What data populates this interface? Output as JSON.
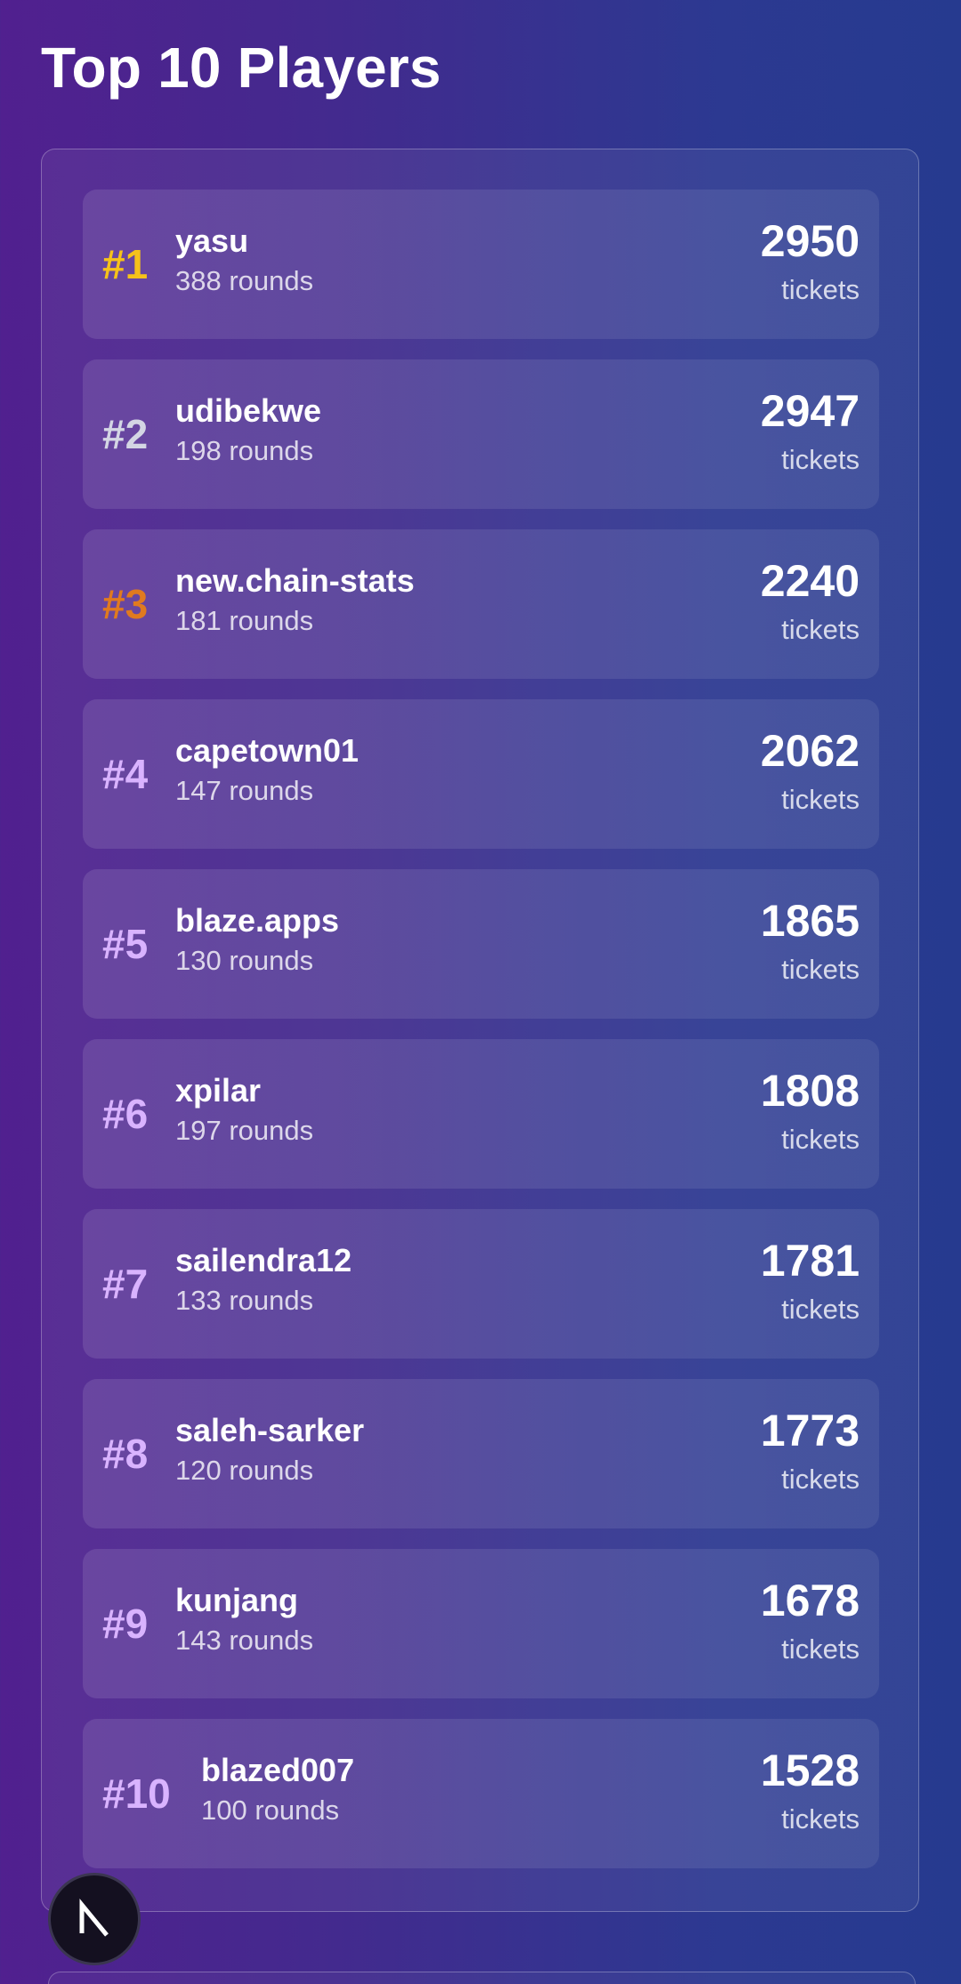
{
  "page": {
    "title": "Top 10 Players"
  },
  "leaderboard": [
    {
      "rank": "#1",
      "name": "yasu",
      "rounds": "388 rounds",
      "tickets": "2950",
      "unit": "tickets",
      "rank_color": "#f6c21a"
    },
    {
      "rank": "#2",
      "name": "udibekwe",
      "rounds": "198 rounds",
      "tickets": "2947",
      "unit": "tickets",
      "rank_color": "#d4d6e4"
    },
    {
      "rank": "#3",
      "name": "new.chain-stats",
      "rounds": "181 rounds",
      "tickets": "2240",
      "unit": "tickets",
      "rank_color": "#e07a1f"
    },
    {
      "rank": "#4",
      "name": "capetown01",
      "rounds": "147 rounds",
      "tickets": "2062",
      "unit": "tickets",
      "rank_color": "#d9b3ff"
    },
    {
      "rank": "#5",
      "name": "blaze.apps",
      "rounds": "130 rounds",
      "tickets": "1865",
      "unit": "tickets",
      "rank_color": "#d9b3ff"
    },
    {
      "rank": "#6",
      "name": "xpilar",
      "rounds": "197 rounds",
      "tickets": "1808",
      "unit": "tickets",
      "rank_color": "#d9b3ff"
    },
    {
      "rank": "#7",
      "name": "sailendra12",
      "rounds": "133 rounds",
      "tickets": "1781",
      "unit": "tickets",
      "rank_color": "#d9b3ff"
    },
    {
      "rank": "#8",
      "name": "saleh-sarker",
      "rounds": "120 rounds",
      "tickets": "1773",
      "unit": "tickets",
      "rank_color": "#d9b3ff"
    },
    {
      "rank": "#9",
      "name": "kunjang",
      "rounds": "143 rounds",
      "tickets": "1678",
      "unit": "tickets",
      "rank_color": "#d9b3ff"
    },
    {
      "rank": "#10",
      "name": "blazed007",
      "rounds": "100 rounds",
      "tickets": "1528",
      "unit": "tickets",
      "rank_color": "#d9b3ff"
    }
  ],
  "badge": {
    "icon": "nextjs-n-icon",
    "letter": "N"
  },
  "colors": {
    "background_start": "#51208f",
    "background_end": "#263a8f",
    "gold": "#f6c21a",
    "silver": "#d4d6e4",
    "bronze": "#e07a1f",
    "rank_default": "#d9b3ff"
  }
}
